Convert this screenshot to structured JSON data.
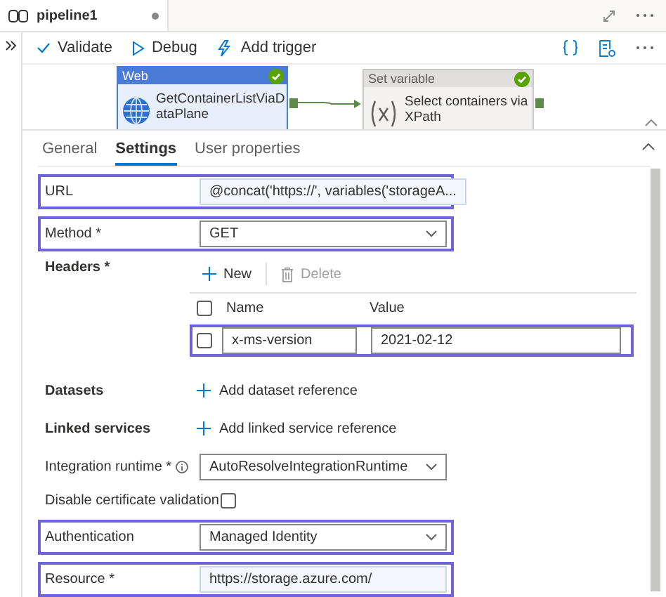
{
  "document_tab": {
    "title": "pipeline1",
    "unsaved": true
  },
  "toolbar": {
    "buttons": [
      {
        "label": "Validate",
        "kind": "validate"
      },
      {
        "label": "Debug",
        "kind": "debug"
      },
      {
        "label": "Add trigger",
        "kind": "trigger"
      }
    ]
  },
  "activities": [
    {
      "type": "Web",
      "kind": "web",
      "name": "GetContainerListViaDataPlane",
      "succeeded": true
    },
    {
      "type": "Set variable",
      "kind": "variable",
      "name": "Select containers via XPath",
      "succeeded": true
    }
  ],
  "properties": {
    "tabs": [
      {
        "label": "General",
        "selected": false
      },
      {
        "label": "Settings",
        "selected": true
      },
      {
        "label": "User properties",
        "selected": false
      }
    ],
    "fields": [
      {
        "kind": "text",
        "label": "URL",
        "value": "@concat('https://', variables('storageA...",
        "highlighted": true
      },
      {
        "kind": "select",
        "label": "Method *",
        "value": "GET",
        "highlighted": true
      },
      {
        "kind": "headers",
        "label": "Headers *",
        "actions": [
          {
            "label": "New",
            "kind": "new",
            "disabled": false
          },
          {
            "label": "Delete",
            "kind": "delete",
            "disabled": true
          }
        ],
        "columns": [
          "Name",
          "Value"
        ],
        "all_checked": false,
        "rows": [
          {
            "name": "x-ms-version",
            "value": "2021-02-12",
            "checked": false,
            "highlighted": true
          }
        ]
      },
      {
        "kind": "add",
        "label": "Datasets",
        "action": "Add dataset reference"
      },
      {
        "kind": "add",
        "label": "Linked services",
        "action": "Add linked service reference"
      },
      {
        "kind": "select",
        "label": "Integration runtime *",
        "info": true,
        "value": "AutoResolveIntegrationRuntime",
        "highlighted": false
      },
      {
        "kind": "checkbox",
        "label": "Disable certificate validation",
        "checked": false
      },
      {
        "kind": "select",
        "label": "Authentication",
        "value": "Managed Identity",
        "highlighted": true
      },
      {
        "kind": "text",
        "label": "Resource *",
        "value": "https://storage.azure.com/",
        "highlighted": true
      }
    ]
  }
}
